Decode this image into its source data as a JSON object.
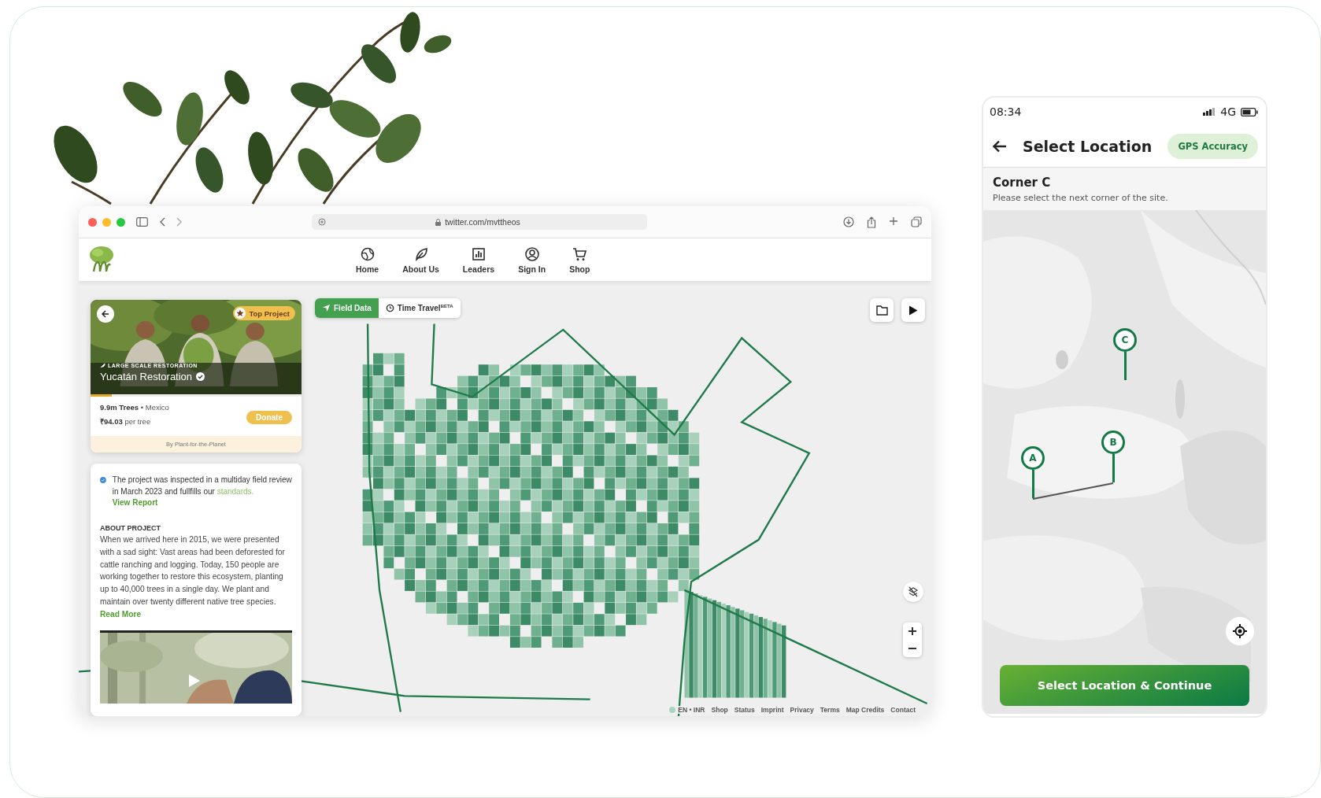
{
  "browser": {
    "url": "twitter.com/mvttheos"
  },
  "nav": [
    {
      "label": "Home"
    },
    {
      "label": "About Us"
    },
    {
      "label": "Leaders"
    },
    {
      "label": "Sign In"
    },
    {
      "label": "Shop"
    }
  ],
  "map_tabs": [
    {
      "label": "Field Data",
      "selected": true
    },
    {
      "label": "Time Travel$^{BETA}$",
      "selected": false
    }
  ],
  "project": {
    "badge": "Top Project",
    "category": "LARGE SCALE RESTORATION",
    "name": "Yucatán Restoration",
    "level": 0.1,
    "stats": "**9.9m Trees** • Mexico",
    "price": "**₹94.03** per tree",
    "donate": "Donate",
    "by": "By Plant-for-the-Planet"
  },
  "review": {
    "text": "The project was inspected in a multiday field review in March 2023 and fullfills our",
    "link": "standards.",
    "report": "View Report"
  },
  "about": {
    "heading": "ABOUT PROJECT",
    "text": "When we arrived here in 2015, we were presented with a sad sight: Vast areas had been deforested for cattle ranching and logging. Today, 150 people are working together to restore this ecosystem, planting up to 40,000 trees in a single day. We plant and maintain over twenty different native tree species.",
    "link": "Read More"
  },
  "footer": {
    "locale": "EN • INR",
    "links": [
      "Shop",
      "Status",
      "Imprint",
      "Privacy",
      "Terms",
      "Map Credits",
      "Contact"
    ]
  },
  "phone": {
    "time": "08:34",
    "network": "4G",
    "title": "Select Location",
    "gps": "GPS Accuracy",
    "corner": "Corner C",
    "hint": "Please select the next corner of the site.",
    "markers": [
      {
        "label": "A"
      },
      {
        "label": "B"
      },
      {
        "label": "C"
      }
    ],
    "button": "Select Location & Continue"
  }
}
